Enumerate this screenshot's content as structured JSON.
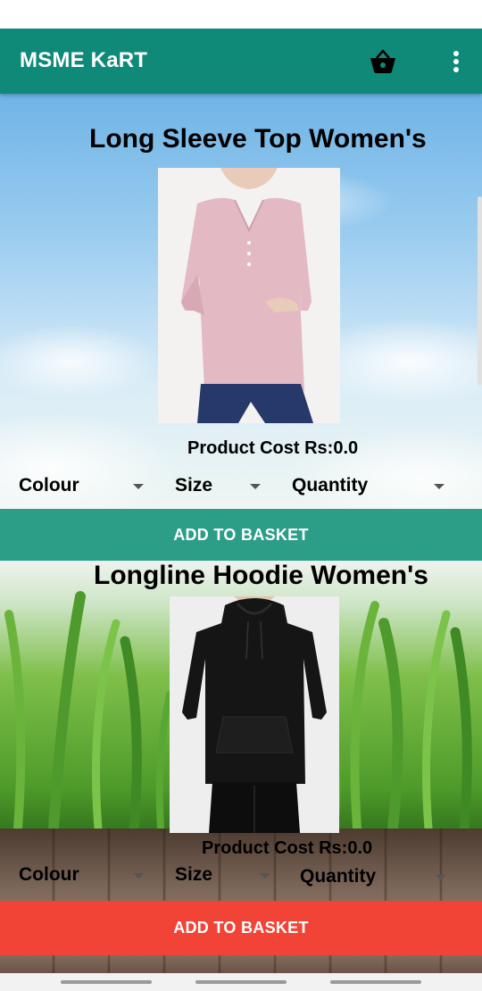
{
  "app": {
    "title": "MSME KaRT",
    "accent_color": "#0f8a78",
    "icons": [
      "basket-icon",
      "overflow-menu-icon"
    ]
  },
  "products": [
    {
      "title": "Long Sleeve Top Women's",
      "image": "pink long sleeve henley top",
      "cost_label": "Product Cost Rs:0.0",
      "colour_label": "Colour",
      "size_label": "Size",
      "quantity_label": "Quantity",
      "button_label": "ADD TO BASKET",
      "button_color": "#2c9d87"
    },
    {
      "title": "Longline Hoodie Women's",
      "image": "black longline hoodie",
      "cost_label": "Product Cost Rs:0.0",
      "colour_label": "Colour",
      "size_label": "Size",
      "quantity_label": "Quantity",
      "button_label": "ADD TO BASKET",
      "button_color": "#f24436"
    }
  ]
}
